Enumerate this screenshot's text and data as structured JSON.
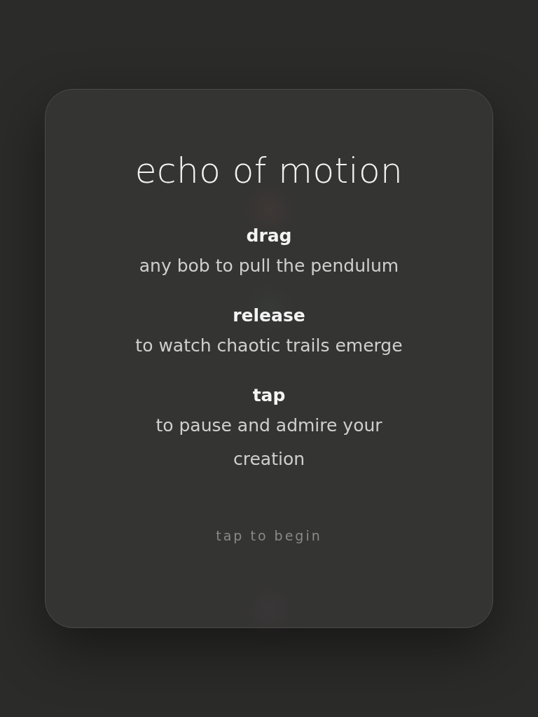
{
  "title": "echo of motion",
  "instructions": [
    {
      "action": "drag",
      "description": "any bob to pull the pendulum"
    },
    {
      "action": "release",
      "description": "to watch chaotic trails emerge"
    },
    {
      "action": "tap",
      "description": "to pause and admire your creation"
    }
  ],
  "prompt": "tap to begin"
}
